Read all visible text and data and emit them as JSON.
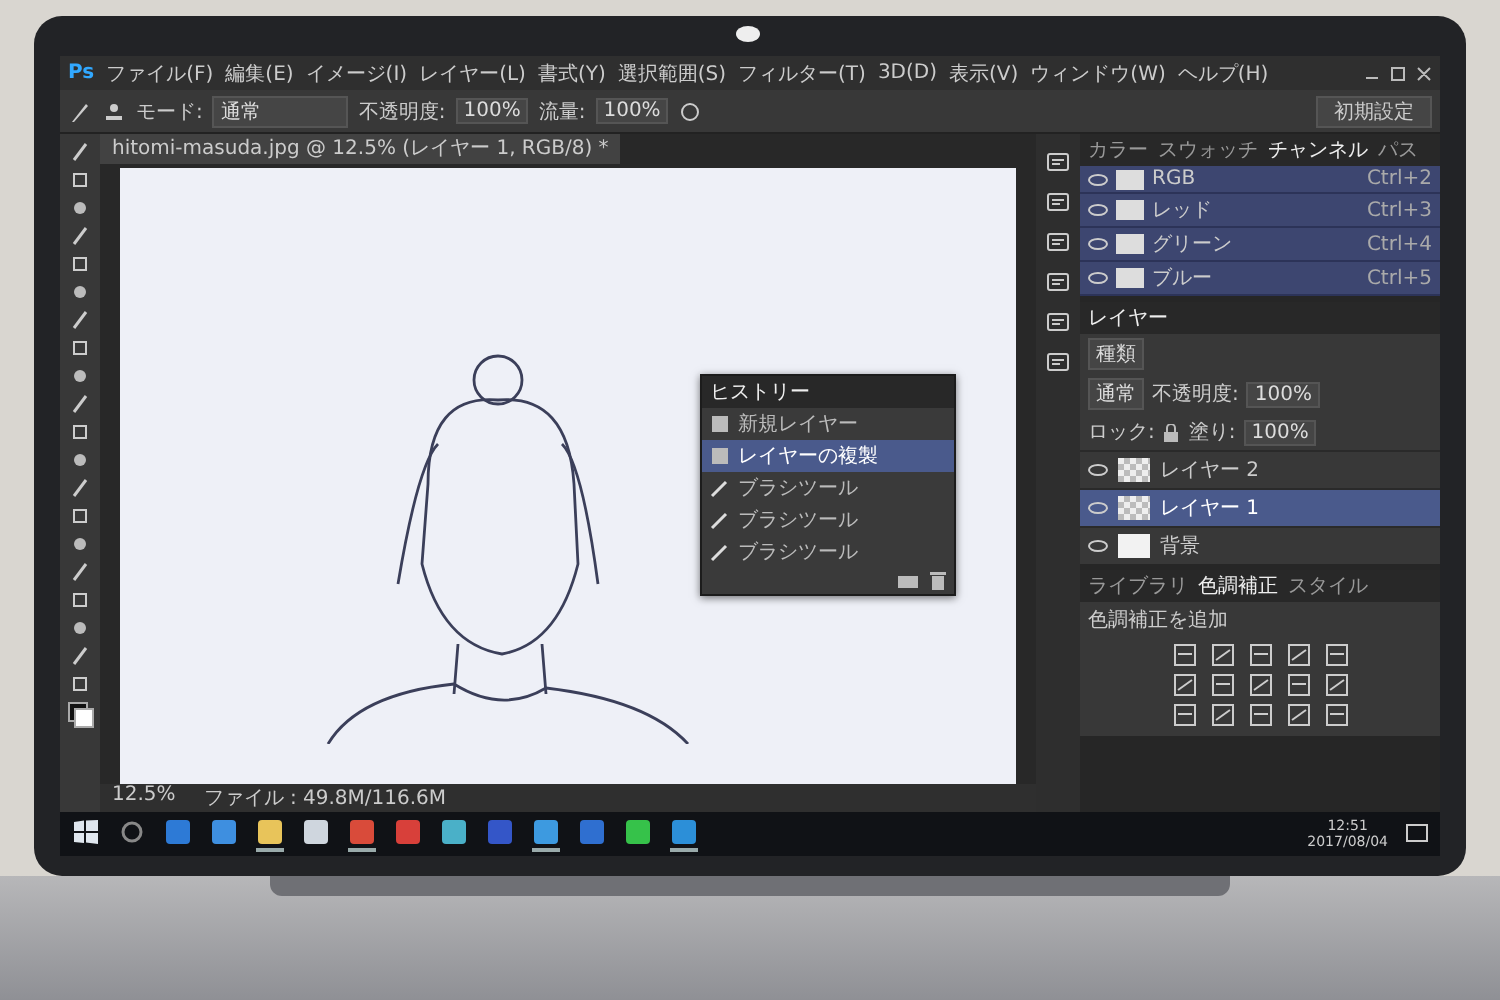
{
  "app_menu": {
    "logo": "Ps",
    "items": [
      "ファイル(F)",
      "編集(E)",
      "イメージ(I)",
      "レイヤー(L)",
      "書式(Y)",
      "選択範囲(S)",
      "フィルター(T)",
      "3D(D)",
      "表示(V)",
      "ウィンドウ(W)",
      "ヘルプ(H)"
    ]
  },
  "options_bar": {
    "mode_label": "モード:",
    "mode_value": "通常",
    "opacity_label": "不透明度:",
    "opacity_value": "100%",
    "flow_label": "流量:",
    "flow_value": "100%",
    "workspace": "初期設定"
  },
  "document": {
    "tab": "hitomi-masuda.jpg @ 12.5% (レイヤー 1, RGB/8) *",
    "status_zoom": "12.5%",
    "status_info": "ファイル : 49.8M/116.6M"
  },
  "history_panel": {
    "title": "ヒストリー",
    "items": [
      {
        "label": "新規レイヤー",
        "kind": "layer",
        "selected": false
      },
      {
        "label": "レイヤーの複製",
        "kind": "layer",
        "selected": true
      },
      {
        "label": "ブラシツール",
        "kind": "brush",
        "selected": false
      },
      {
        "label": "ブラシツール",
        "kind": "brush",
        "selected": false
      },
      {
        "label": "ブラシツール",
        "kind": "brush",
        "selected": false
      }
    ]
  },
  "channels_panel": {
    "tabs": [
      {
        "label": "カラー",
        "selected": false
      },
      {
        "label": "スウォッチ",
        "selected": false
      },
      {
        "label": "チャンネル",
        "selected": true
      },
      {
        "label": "パス",
        "selected": false
      }
    ],
    "channels": [
      {
        "name": "RGB",
        "shortcut": "Ctrl+2"
      },
      {
        "name": "レッド",
        "shortcut": "Ctrl+3"
      },
      {
        "name": "グリーン",
        "shortcut": "Ctrl+4"
      },
      {
        "name": "ブルー",
        "shortcut": "Ctrl+5"
      }
    ]
  },
  "layers_panel": {
    "title": "レイヤー",
    "filter": "種類",
    "blend_mode": "通常",
    "opacity_label": "不透明度:",
    "opacity_value": "100%",
    "lock_label": "ロック:",
    "fill_label": "塗り:",
    "fill_value": "100%",
    "layers": [
      {
        "name": "レイヤー 2",
        "kind": "layer",
        "selected": false
      },
      {
        "name": "レイヤー 1",
        "kind": "layer",
        "selected": true
      },
      {
        "name": "背景",
        "kind": "background",
        "selected": false
      }
    ]
  },
  "adjustments_panel": {
    "tabs": [
      {
        "label": "ライブラリ",
        "selected": false
      },
      {
        "label": "色調補正",
        "selected": true
      },
      {
        "label": "スタイル",
        "selected": false
      }
    ],
    "heading": "色調補正を追加"
  },
  "taskbar": {
    "apps": [
      {
        "kind": "start",
        "running": false
      },
      {
        "kind": "search",
        "running": false
      },
      {
        "kind": "e",
        "running": false
      },
      {
        "kind": "e2",
        "running": false
      },
      {
        "kind": "folder",
        "running": true
      },
      {
        "kind": "bag",
        "running": false
      },
      {
        "kind": "globe",
        "running": true
      },
      {
        "kind": "red",
        "running": false
      },
      {
        "kind": "teal",
        "running": false
      },
      {
        "kind": "blue",
        "running": false
      },
      {
        "kind": "sky",
        "running": true
      },
      {
        "kind": "calendar",
        "running": false
      },
      {
        "kind": "chat",
        "running": false
      },
      {
        "kind": "ps",
        "running": true
      }
    ],
    "time": "12:51",
    "date": "2017/08/04"
  }
}
